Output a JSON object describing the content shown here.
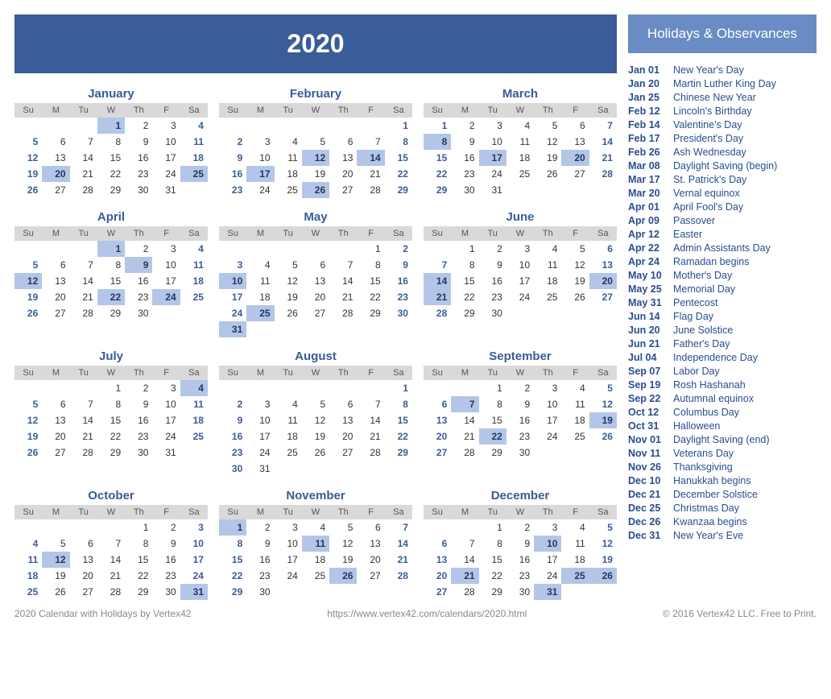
{
  "year": "2020",
  "holidays_header": "Holidays & Observances",
  "dow": [
    "Su",
    "M",
    "Tu",
    "W",
    "Th",
    "F",
    "Sa"
  ],
  "months": [
    {
      "name": "January",
      "start": 3,
      "ndays": 31,
      "hl": [
        1,
        20,
        25
      ]
    },
    {
      "name": "February",
      "start": 6,
      "ndays": 29,
      "hl": [
        12,
        14,
        17,
        26
      ]
    },
    {
      "name": "March",
      "start": 0,
      "ndays": 31,
      "hl": [
        8,
        17,
        20
      ]
    },
    {
      "name": "April",
      "start": 3,
      "ndays": 30,
      "hl": [
        1,
        9,
        12,
        22,
        24
      ]
    },
    {
      "name": "May",
      "start": 5,
      "ndays": 31,
      "hl": [
        10,
        25,
        31
      ]
    },
    {
      "name": "June",
      "start": 1,
      "ndays": 30,
      "hl": [
        14,
        20,
        21
      ]
    },
    {
      "name": "July",
      "start": 3,
      "ndays": 31,
      "hl": [
        4
      ]
    },
    {
      "name": "August",
      "start": 6,
      "ndays": 31,
      "hl": []
    },
    {
      "name": "September",
      "start": 2,
      "ndays": 30,
      "hl": [
        7,
        19,
        22
      ]
    },
    {
      "name": "October",
      "start": 4,
      "ndays": 31,
      "hl": [
        12,
        31
      ]
    },
    {
      "name": "November",
      "start": 0,
      "ndays": 30,
      "hl": [
        1,
        11,
        26
      ]
    },
    {
      "name": "December",
      "start": 2,
      "ndays": 31,
      "hl": [
        10,
        21,
        25,
        26,
        31
      ]
    }
  ],
  "holidays": [
    {
      "date": "Jan 01",
      "name": "New Year's Day"
    },
    {
      "date": "Jan 20",
      "name": "Martin Luther King Day"
    },
    {
      "date": "Jan 25",
      "name": "Chinese New Year"
    },
    {
      "date": "Feb 12",
      "name": "Lincoln's Birthday"
    },
    {
      "date": "Feb 14",
      "name": "Valentine's Day"
    },
    {
      "date": "Feb 17",
      "name": "President's Day"
    },
    {
      "date": "Feb 26",
      "name": "Ash Wednesday"
    },
    {
      "date": "Mar 08",
      "name": "Daylight Saving (begin)"
    },
    {
      "date": "Mar 17",
      "name": "St. Patrick's Day"
    },
    {
      "date": "Mar 20",
      "name": "Vernal equinox"
    },
    {
      "date": "Apr 01",
      "name": "April Fool's Day"
    },
    {
      "date": "Apr 09",
      "name": "Passover"
    },
    {
      "date": "Apr 12",
      "name": "Easter"
    },
    {
      "date": "Apr 22",
      "name": "Admin Assistants Day"
    },
    {
      "date": "Apr 24",
      "name": "Ramadan begins"
    },
    {
      "date": "May 10",
      "name": "Mother's Day"
    },
    {
      "date": "May 25",
      "name": "Memorial Day"
    },
    {
      "date": "May 31",
      "name": "Pentecost"
    },
    {
      "date": "Jun 14",
      "name": "Flag Day"
    },
    {
      "date": "Jun 20",
      "name": "June Solstice"
    },
    {
      "date": "Jun 21",
      "name": "Father's Day"
    },
    {
      "date": "Jul 04",
      "name": "Independence Day"
    },
    {
      "date": "Sep 07",
      "name": "Labor Day"
    },
    {
      "date": "Sep 19",
      "name": "Rosh Hashanah"
    },
    {
      "date": "Sep 22",
      "name": "Autumnal equinox"
    },
    {
      "date": "Oct 12",
      "name": "Columbus Day"
    },
    {
      "date": "Oct 31",
      "name": "Halloween"
    },
    {
      "date": "Nov 01",
      "name": "Daylight Saving (end)"
    },
    {
      "date": "Nov 11",
      "name": "Veterans Day"
    },
    {
      "date": "Nov 26",
      "name": "Thanksgiving"
    },
    {
      "date": "Dec 10",
      "name": "Hanukkah begins"
    },
    {
      "date": "Dec 21",
      "name": "December Solstice"
    },
    {
      "date": "Dec 25",
      "name": "Christmas Day"
    },
    {
      "date": "Dec 26",
      "name": "Kwanzaa begins"
    },
    {
      "date": "Dec 31",
      "name": "New Year's Eve"
    }
  ],
  "footer": {
    "left": "2020 Calendar with Holidays by Vertex42",
    "center": "https://www.vertex42.com/calendars/2020.html",
    "right": "© 2016 Vertex42 LLC. Free to Print."
  }
}
